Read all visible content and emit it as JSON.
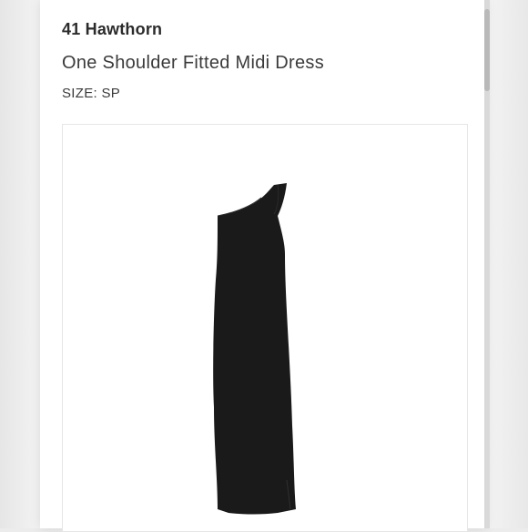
{
  "product": {
    "brand": "41 Hawthorn",
    "title": "One Shoulder Fitted Midi Dress",
    "size_label": "SIZE: SP"
  },
  "image": {
    "icon": "dress-photo",
    "dress_color": "#1a1a1a"
  }
}
